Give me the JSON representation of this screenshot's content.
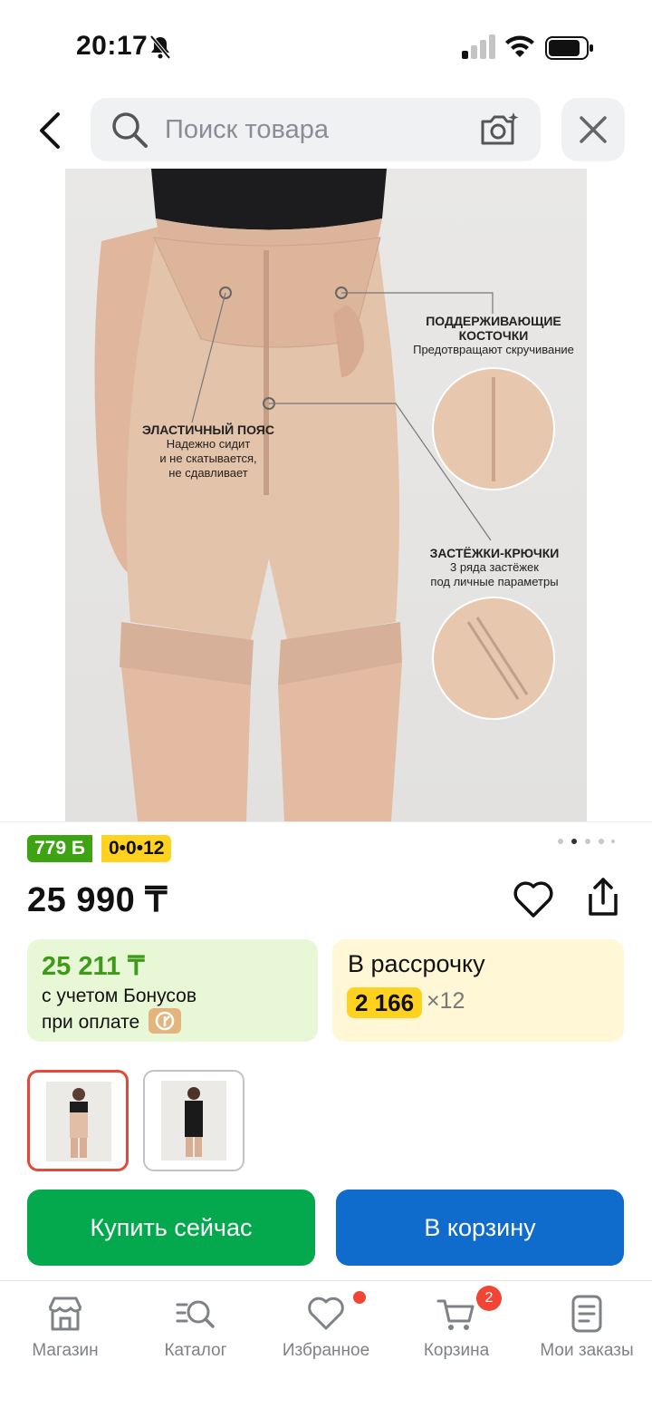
{
  "status_bar": {
    "time": "20:17"
  },
  "header": {
    "search_placeholder": "Поиск товара"
  },
  "product_image": {
    "annotations": [
      {
        "title": "ЭЛАСТИЧНЫЙ ПОЯС",
        "lines": [
          "Надежно сидит",
          "и не скатывается,",
          "не сдавливает"
        ]
      },
      {
        "title": "ПОДДЕРЖИВАЮЩИЕ КОСТОЧКИ",
        "lines": [
          "Предотвращают скручивание"
        ]
      },
      {
        "title": "ЗАСТЁЖКИ-КРЮЧКИ",
        "lines": [
          "3 ряда застёжек",
          "под личные параметры"
        ]
      }
    ]
  },
  "badges": {
    "bonus": "779 Б",
    "installment": "0•0•12"
  },
  "product": {
    "price": "25 990 ₸"
  },
  "bonus_card": {
    "value": "25 211 ₸",
    "line1": "с учетом Бонусов",
    "line2": "при оплате"
  },
  "installment_card": {
    "title": "В рассрочку",
    "amount": "2 166",
    "multiplier": "×12"
  },
  "actions": {
    "buy_now": "Купить сейчас",
    "add_to_cart": "В корзину"
  },
  "tabbar": {
    "items": [
      {
        "label": "Магазин",
        "icon": "store-icon"
      },
      {
        "label": "Каталог",
        "icon": "catalog-icon"
      },
      {
        "label": "Избранное",
        "icon": "heart-icon"
      },
      {
        "label": "Корзина",
        "icon": "cart-icon"
      },
      {
        "label": "Мои заказы",
        "icon": "orders-icon"
      }
    ],
    "cart_count": "2"
  },
  "colors": {
    "bonus_green": "#3ea312",
    "accent_yellow": "#ffd21f",
    "buy_green": "#04a94e",
    "cart_blue": "#0f6bcc",
    "badge_red": "#f14635"
  }
}
